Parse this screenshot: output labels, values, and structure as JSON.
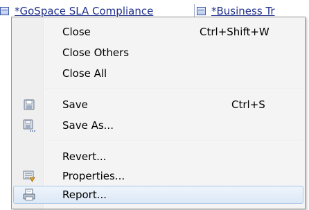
{
  "tabs": [
    {
      "label": "*GoSpace SLA Compliance"
    },
    {
      "label": "*Business Tr"
    }
  ],
  "menu": {
    "items": [
      {
        "label": "Close",
        "shortcut": "Ctrl+Shift+W"
      },
      {
        "label": "Close Others"
      },
      {
        "label": "Close All"
      },
      {
        "label": "Save",
        "shortcut": "Ctrl+S",
        "icon": "save-icon"
      },
      {
        "label": "Save As...",
        "icon": "save-as-icon"
      },
      {
        "label": "Revert..."
      },
      {
        "label": "Properties...",
        "icon": "properties-icon"
      },
      {
        "label": "Report...",
        "icon": "report-icon",
        "highlighted": true
      }
    ]
  },
  "colors": {
    "menu_background": "#f4f4f4",
    "highlight": "#dce8f6",
    "highlight_border": "#a8c8ea",
    "tab_text": "#1f2f8c"
  }
}
